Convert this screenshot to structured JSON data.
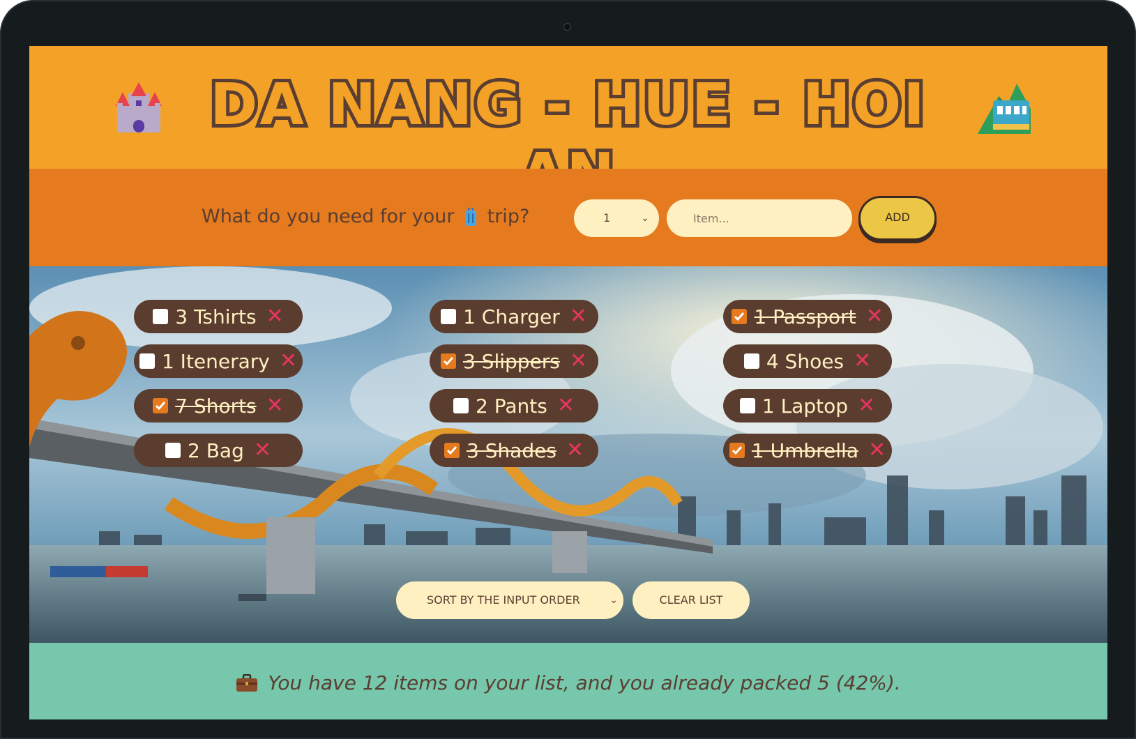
{
  "header": {
    "title": "DA NANG - HUE - HOI AN",
    "left_icon": "castle-icon",
    "right_icon": "mountain-railway-icon"
  },
  "form": {
    "question": "What do you need for your",
    "question_suffix": "trip?",
    "question_icon": "luggage-icon",
    "quantity_value": "1",
    "item_placeholder": "Item...",
    "add_label": "ADD"
  },
  "items": [
    {
      "label": "3 Tshirts",
      "packed": false
    },
    {
      "label": "1 Itenerary",
      "packed": false
    },
    {
      "label": "7 Shorts",
      "packed": true
    },
    {
      "label": "2 Bag",
      "packed": false
    },
    {
      "label": "1 Charger",
      "packed": false
    },
    {
      "label": "3 Slippers",
      "packed": true
    },
    {
      "label": "2 Pants",
      "packed": false
    },
    {
      "label": "3 Shades",
      "packed": true
    },
    {
      "label": "1 Passport",
      "packed": true
    },
    {
      "label": "4 Shoes",
      "packed": false
    },
    {
      "label": "1 Laptop",
      "packed": false
    },
    {
      "label": "1 Umbrella",
      "packed": true
    }
  ],
  "controls": {
    "sort_value": "SORT BY THE INPUT ORDER",
    "clear_label": "CLEAR LIST"
  },
  "stats": {
    "icon": "briefcase-icon",
    "text": "You have 12 items on your list, and you already packed 5 (42%)."
  },
  "colors": {
    "header_bg": "#f4a227",
    "form_bg": "#e57a1e",
    "pill_bg": "#5a3d2f",
    "stats_bg": "#76c7ab",
    "delete": "#e8345e",
    "text_dark": "#5a3e32",
    "cream": "#fff0c2",
    "add_button": "#ecc746"
  }
}
